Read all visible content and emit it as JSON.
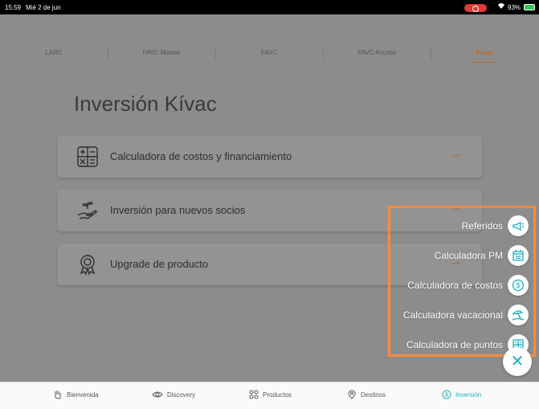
{
  "status_bar": {
    "time": "15:59",
    "date": "Mié 2 de jun",
    "battery_pct": "93%"
  },
  "tabs": [
    {
      "label": "LARC"
    },
    {
      "label": "FAVC Master"
    },
    {
      "label": "FAVC"
    },
    {
      "label": "FAVC Access"
    },
    {
      "label": "Kívac"
    }
  ],
  "active_tab": "Kívac",
  "page_title": "Inversión Kívac",
  "cards": [
    {
      "label": "Calculadora de costos y financiamiento",
      "icon": "calculator-icon"
    },
    {
      "label": "Inversión para nuevos socios",
      "icon": "hand-plant-icon"
    },
    {
      "label": "Upgrade de producto",
      "icon": "award-badge-icon"
    }
  ],
  "fab_menu": [
    {
      "label": "Referidos",
      "icon": "megaphone-icon"
    },
    {
      "label": "Calculadora PM",
      "icon": "calendar-icon"
    },
    {
      "label": "Calculadora de costos",
      "icon": "dollar-coin-icon"
    },
    {
      "label": "Calculadora vacacional",
      "icon": "beach-umbrella-icon"
    },
    {
      "label": "Calculadora de puntos",
      "icon": "grid-calculator-icon"
    }
  ],
  "bottom_nav": [
    {
      "label": "Bienvenida",
      "icon": "hand-wave-icon"
    },
    {
      "label": "Discovery",
      "icon": "eye-icon"
    },
    {
      "label": "Productos",
      "icon": "grid-icon"
    },
    {
      "label": "Destinos",
      "icon": "map-pin-icon"
    },
    {
      "label": "Inversión",
      "icon": "dollar-circle-icon"
    }
  ],
  "colors": {
    "accent": "#1eaec0",
    "brand_orange": "#b86a2a",
    "highlight_border": "#ff8a3d"
  }
}
